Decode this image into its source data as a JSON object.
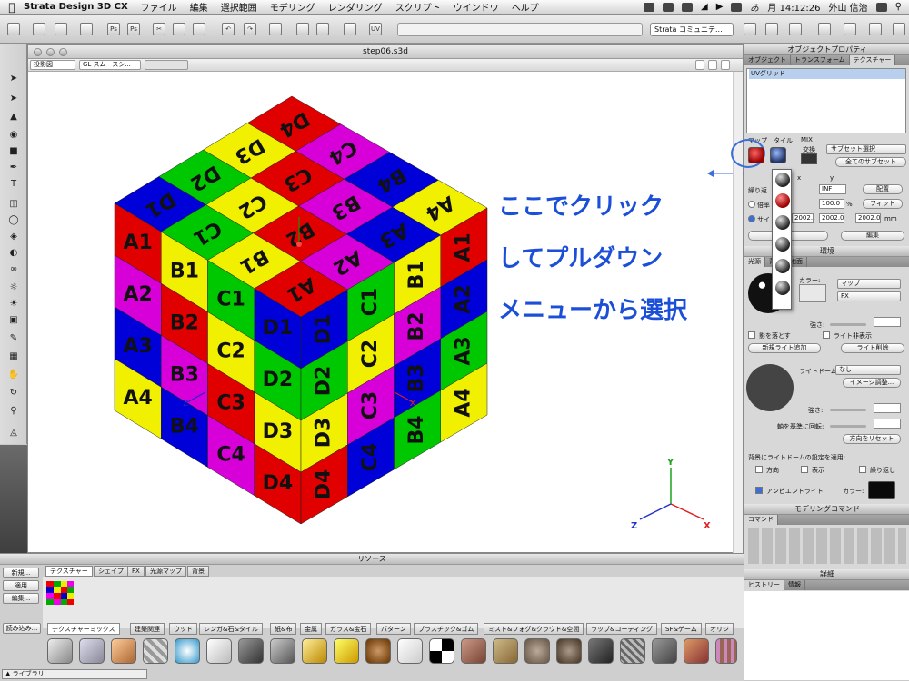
{
  "menubar": {
    "app_name": "Strata Design 3D CX",
    "items": [
      "ファイル",
      "編集",
      "選択範囲",
      "モデリング",
      "レンダリング",
      "スクリプト",
      "ウインドウ",
      "ヘルプ"
    ],
    "status_icon_label": "あ",
    "clock": "月 14:12:26",
    "user": "外山 信治"
  },
  "toolbar": {
    "community_select": "Strata コミュニテ..."
  },
  "document": {
    "title": "step06.s3d",
    "view_select": "投影図",
    "render_select": "GL スムースシ..."
  },
  "callout": {
    "lines": [
      "ここでクリック",
      "してプルダウン",
      "メニューから選択"
    ],
    "color": "#1b4fd8"
  },
  "cube": {
    "top_labels": [
      "D4",
      "C4",
      "B4",
      "A4",
      "D3",
      "C3",
      "B3",
      "A3",
      "D2",
      "C2",
      "B2",
      "A2",
      "D1",
      "C1",
      "B1",
      "A1"
    ],
    "left_labels": [
      "A1",
      "B1",
      "C1",
      "D1",
      "A2",
      "B2",
      "C2",
      "D2",
      "A3",
      "B3",
      "C3",
      "D3",
      "A4",
      "B4",
      "C4",
      "D4"
    ],
    "right_labels": [
      "D1",
      "D2",
      "D3",
      "D4",
      "C1",
      "C2",
      "C3",
      "C4",
      "B1",
      "B2",
      "B3",
      "B4",
      "A1",
      "A2",
      "A3",
      "A4"
    ]
  },
  "gizmo": {
    "x": "X",
    "y": "Y",
    "z": "Z",
    "left_axis_z": "Z",
    "right_axis_x": "X"
  },
  "object_panel": {
    "title": "オブジェクトプロパティ",
    "tabs": [
      "オブジェクト",
      "トランスフォーム",
      "テクスチャー"
    ],
    "texture_item": "UVグリッド",
    "map_label": "マップ",
    "tile_label": "タイル",
    "mix_label": "MIX",
    "swap_label": "交換",
    "subset_select": "サブセット選択",
    "all_subsets_button": "全てのサブセット",
    "x_label": "x",
    "y_label": "y",
    "y_value": "INF",
    "repeat_label": "繰り返",
    "place_button": "配置",
    "scale_label": "倍率",
    "scale_value": "100.0",
    "percent_sign": "%",
    "fit_button": "フィット",
    "size_label": "サイ",
    "size_value1": "2002.0",
    "size_value2": "2002.0",
    "size_value3": "2002.0",
    "unit": "mm",
    "edit_button": "編集"
  },
  "environment_panel": {
    "title": "環境",
    "tabs": [
      "光源",
      "背景",
      "地面"
    ],
    "color_label": "カラー:",
    "map_select": "マップ",
    "fx_select": "FX",
    "strength_label": "強さ:",
    "cast_shadow_label": "影を落とす",
    "light_hidden_label": "ライト非表示",
    "add_light_button": "新規ライト追加",
    "delete_light_button": "ライト削除",
    "light_dome_label": "ライトドーム:",
    "light_dome_value": "なし",
    "image_adjust_button": "イメージ調整...",
    "strength2_label": "強さ:",
    "rotate_label": "軸を基準に回転:",
    "reset_button": "方向をリセット",
    "apply_label": "背景にライトドームの設定を適用:",
    "opt_direction": "方向",
    "opt_display": "表示",
    "opt_repeat": "繰り返し",
    "ambient_label": "アンビエントライト",
    "ambient_color_label": "カラー:"
  },
  "modeling_panel": {
    "title": "モデリングコマンド",
    "tab": "コマンド"
  },
  "detail_panel": {
    "title": "詳細",
    "tabs": [
      "ヒストリー",
      "情報"
    ]
  },
  "resources": {
    "title": "リソース",
    "buttons": [
      "新規...",
      "適用",
      "編集...",
      "読み込み..."
    ],
    "tabs": [
      "テクスチャー",
      "シェイプ",
      "FX",
      "光源マップ",
      "背景"
    ],
    "categories": [
      "テクスチャーミックス",
      "建築関連",
      "ウッド",
      "レンガ&石&タイル",
      "紙&布",
      "金属",
      "ガラス&宝石",
      "パターン",
      "プラスチック&ゴム",
      "ミスト&フォグ&クラウド&空間",
      "ラップ&コーティング",
      "SF&ゲーム",
      "オリジ"
    ],
    "library_label": "ライブラリ",
    "thumb_label": "UVグリッド"
  }
}
